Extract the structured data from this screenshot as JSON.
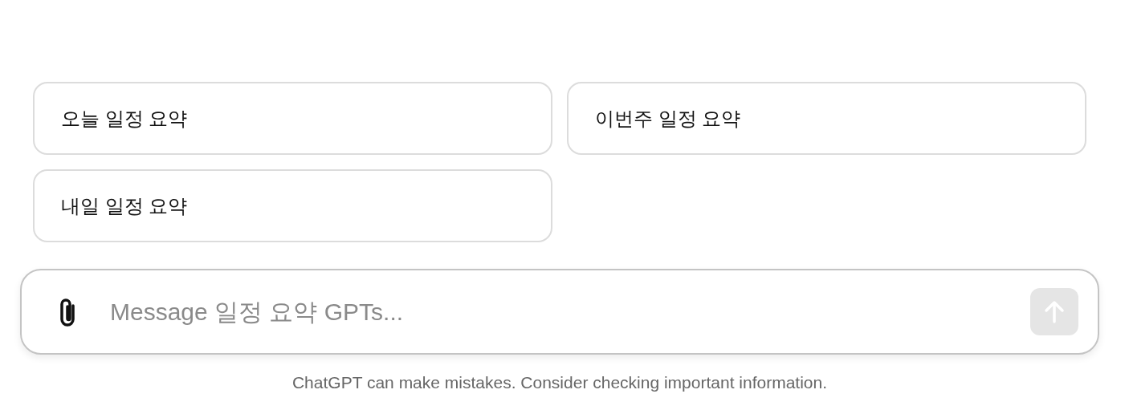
{
  "suggestions": [
    {
      "label": "오늘 일정 요약"
    },
    {
      "label": "이번주 일정 요약"
    },
    {
      "label": "내일 일정 요약"
    }
  ],
  "composer": {
    "placeholder": "Message 일정 요약 GPTs...",
    "send_disabled": true
  },
  "footer": "ChatGPT can make mistakes. Consider checking important information."
}
